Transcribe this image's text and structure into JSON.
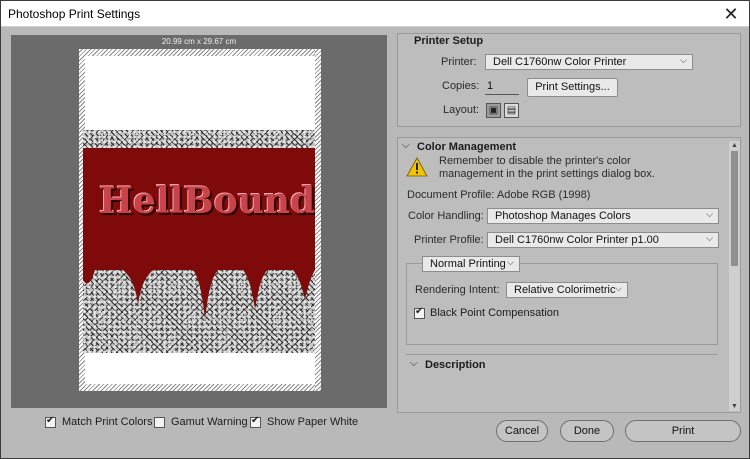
{
  "window": {
    "title": "Photoshop Print Settings",
    "close_glyph": "✕"
  },
  "preview": {
    "paper_dims": "20.99 cm x 29.67 cm",
    "art_text": "HellBound",
    "checkboxes": [
      {
        "label": "Match Print Colors",
        "checked": true
      },
      {
        "label": "Gamut Warning",
        "checked": false
      },
      {
        "label": "Show Paper White",
        "checked": true
      }
    ]
  },
  "printer_setup": {
    "title": "Printer Setup",
    "printer_label": "Printer:",
    "printer_value": "Dell C1760nw Color Printer",
    "copies_label": "Copies:",
    "copies_value": "1",
    "print_settings_button": "Print Settings...",
    "layout_label": "Layout:",
    "layout_icons": [
      "portrait-layout-icon",
      "landscape-layout-icon"
    ]
  },
  "color_management": {
    "title": "Color Management",
    "warning_text": "Remember to disable the printer's color management in the print settings dialog box.",
    "document_profile": "Document Profile: Adobe RGB (1998)",
    "color_handling_label": "Color Handling:",
    "color_handling_value": "Photoshop Manages Colors",
    "printer_profile_label": "Printer Profile:",
    "printer_profile_value": "Dell C1760nw Color Printer p1.00",
    "printing_mode": "Normal Printing",
    "rendering_intent_label": "Rendering Intent:",
    "rendering_intent_value": "Relative Colorimetric",
    "black_point_label": "Black Point Compensation",
    "black_point_checked": true
  },
  "description": {
    "title": "Description"
  },
  "footer": {
    "cancel": "Cancel",
    "done": "Done",
    "print": "Print"
  },
  "colors": {
    "dialog_bg": "#b9b9b9",
    "preview_bg": "#6b6b6b",
    "art_red": "#7f0a0a",
    "warning_yellow": "#f4c300"
  }
}
